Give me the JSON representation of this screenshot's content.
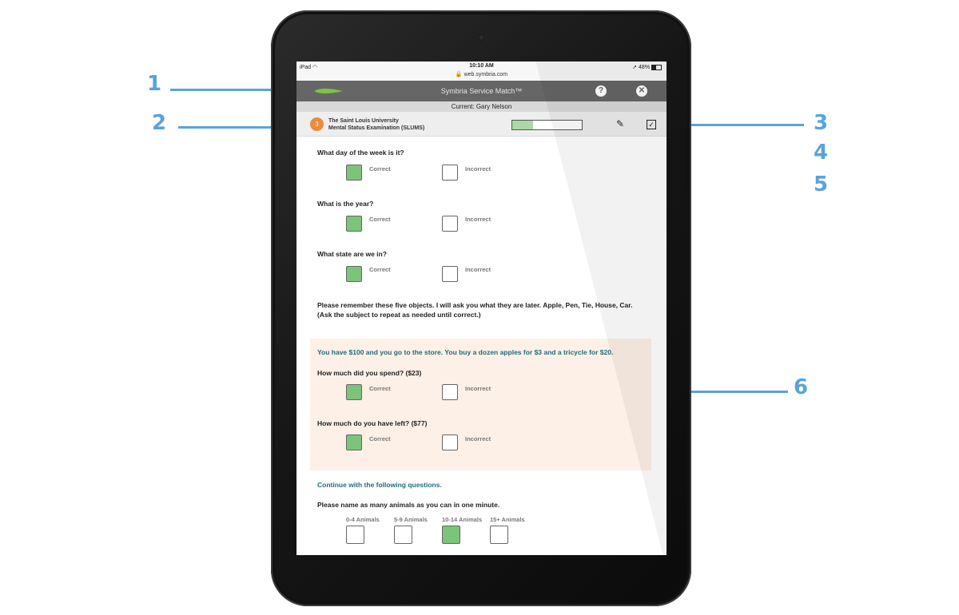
{
  "callouts": [
    "1",
    "2",
    "3",
    "4",
    "5",
    "6"
  ],
  "status_bar": {
    "device": "iPad",
    "time": "10:10 AM",
    "url": "web.symbria.com",
    "battery": "48%"
  },
  "header": {
    "title": "Symbria Service Match™",
    "help_icon": "question-icon",
    "close_icon": "close-icon",
    "current_label": "Current: Gary Nelson"
  },
  "test": {
    "number": "3",
    "name_line1": "The Saint Louis University",
    "name_line2": "Mental Status Examination (SLUMS)",
    "progress": 0.3,
    "edit_icon": "edit-icon",
    "check_icon": "checkbox-check-icon"
  },
  "labels": {
    "correct": "Correct",
    "incorrect": "Incorrect"
  },
  "questions": [
    {
      "text": "What day of the week is it?",
      "answer": "Correct"
    },
    {
      "text": "What is the year?",
      "answer": "Correct"
    },
    {
      "text": "What state are we in?",
      "answer": "Correct"
    }
  ],
  "remember_text": "Please remember these five objects. I will ask you what they are later. Apple, Pen, Tie, House, Car. (Ask the subject to repeat as needed until correct.)",
  "store_section": {
    "intro": "You have $100 and you go to the store. You buy a dozen apples for $3 and a tricycle for $20.",
    "questions": [
      {
        "text": "How much did you spend? ($23)",
        "answer": "Correct"
      },
      {
        "text": "How much do you have left? ($77)",
        "answer": "Correct"
      }
    ]
  },
  "continue_text": "Continue with the following questions.",
  "animals": {
    "question": "Please name as many animals as you can in one minute.",
    "options": [
      "0-4 Animals",
      "5-9 Animals",
      "10-14 Animals",
      "15+ Animals"
    ],
    "selected": "10-14 Animals"
  },
  "colors": {
    "callout": "#5aa3d8",
    "header": "#666666",
    "checked": "#7cc47a",
    "highlight": "#fdf0e6",
    "teal_text": "#1f6d7e",
    "badge": "#ee8a3a"
  }
}
